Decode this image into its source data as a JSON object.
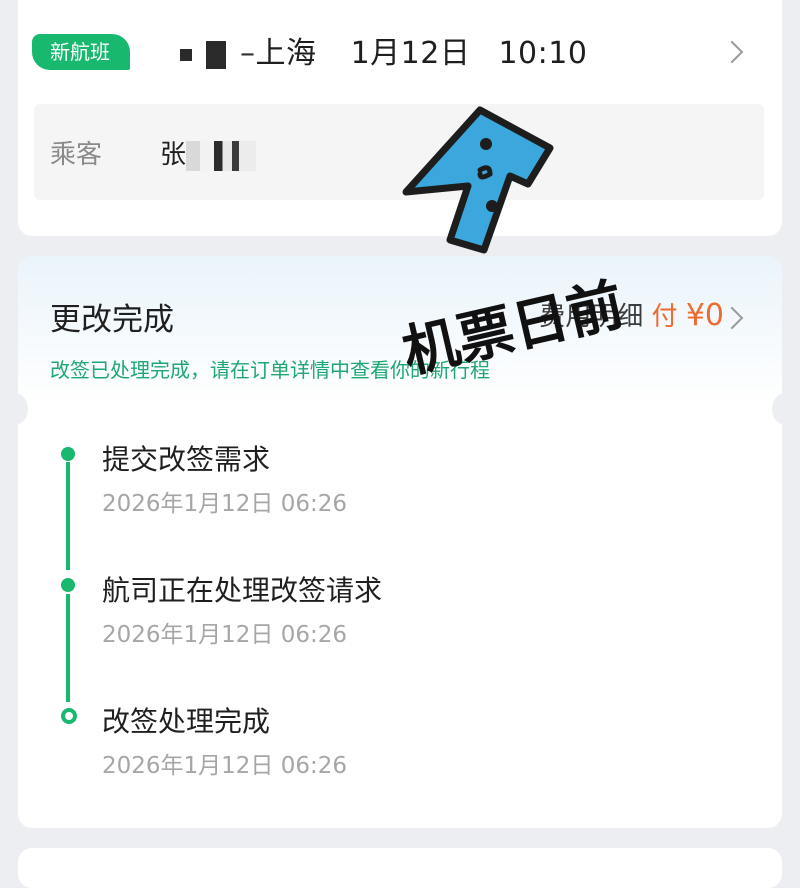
{
  "flight": {
    "badge": "新航班",
    "route_suffix": "上海",
    "date": "1月12日",
    "time": "10:10"
  },
  "passenger": {
    "label": "乘客",
    "name_visible": "张"
  },
  "change_status": {
    "title": "更改完成",
    "fee_label": "费用明细",
    "fee_prefix": "付",
    "fee_amount": "¥0",
    "description": "改签已处理完成，请在订单详情中查看你的新行程",
    "colors": {
      "accent_green": "#19b86f",
      "fee_orange": "#ee6a2f"
    }
  },
  "timeline": [
    {
      "title": "提交改签需求",
      "time": "2026年1月12日 06:26",
      "state": "done"
    },
    {
      "title": "航司正在处理改签请求",
      "time": "2026年1月12日 06:26",
      "state": "done"
    },
    {
      "title": "改签处理完成",
      "time": "2026年1月12日 06:26",
      "state": "current"
    }
  ],
  "overlay": {
    "sticker_text": "机票日前",
    "sticker_icon": "blue-arrow-sticker"
  }
}
